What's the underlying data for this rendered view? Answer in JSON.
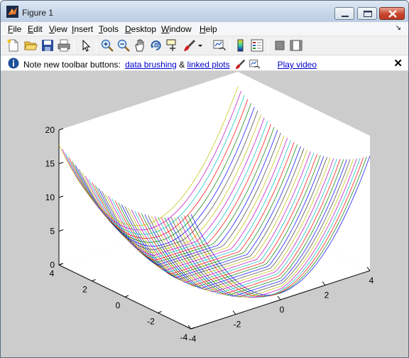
{
  "window": {
    "title": "Figure 1"
  },
  "menu": {
    "items": [
      {
        "label": "File",
        "key": "F"
      },
      {
        "label": "Edit",
        "key": "E"
      },
      {
        "label": "View",
        "key": "V"
      },
      {
        "label": "Insert",
        "key": "I"
      },
      {
        "label": "Tools",
        "key": "T"
      },
      {
        "label": "Desktop",
        "key": "D"
      },
      {
        "label": "Window",
        "key": "W"
      },
      {
        "label": "Help",
        "key": "H"
      }
    ]
  },
  "toolbar": {
    "buttons": [
      "new-figure-icon",
      "open-file-icon",
      "save-figure-icon",
      "print-figure-icon",
      "edit-plot-icon",
      "zoom-in-icon",
      "zoom-out-icon",
      "pan-icon",
      "rotate-3d-icon",
      "data-cursor-icon",
      "brush-icon",
      "link-plot-icon",
      "colorbar-icon",
      "legend-icon",
      "hide-plot-tools-icon",
      "show-plot-tools-icon"
    ]
  },
  "infobar": {
    "prefix": "Note new toolbar buttons:",
    "link1": "data brushing",
    "amp": "&",
    "link2": "linked plots",
    "video": "Play video",
    "close": "✕"
  },
  "chart_data": {
    "type": "line3d",
    "function": "z = x^2 + y^2 / 4 style paraboloid mesh lines",
    "x_range": [
      -4,
      4
    ],
    "y_range": [
      -4,
      4
    ],
    "zlim": [
      0,
      20
    ],
    "z_ticks": [
      "0",
      "5",
      "10",
      "15",
      "20"
    ],
    "x_ticks": [
      "-4",
      "-2",
      "0",
      "2",
      "4"
    ],
    "y_ticks": [
      "-4",
      "-2",
      "0",
      "2",
      "4"
    ],
    "grid": false,
    "line_colors": [
      "#0000ff",
      "#008000",
      "#ff0000",
      "#00bfbf",
      "#bf00bf",
      "#bfbf00",
      "#404040"
    ]
  }
}
